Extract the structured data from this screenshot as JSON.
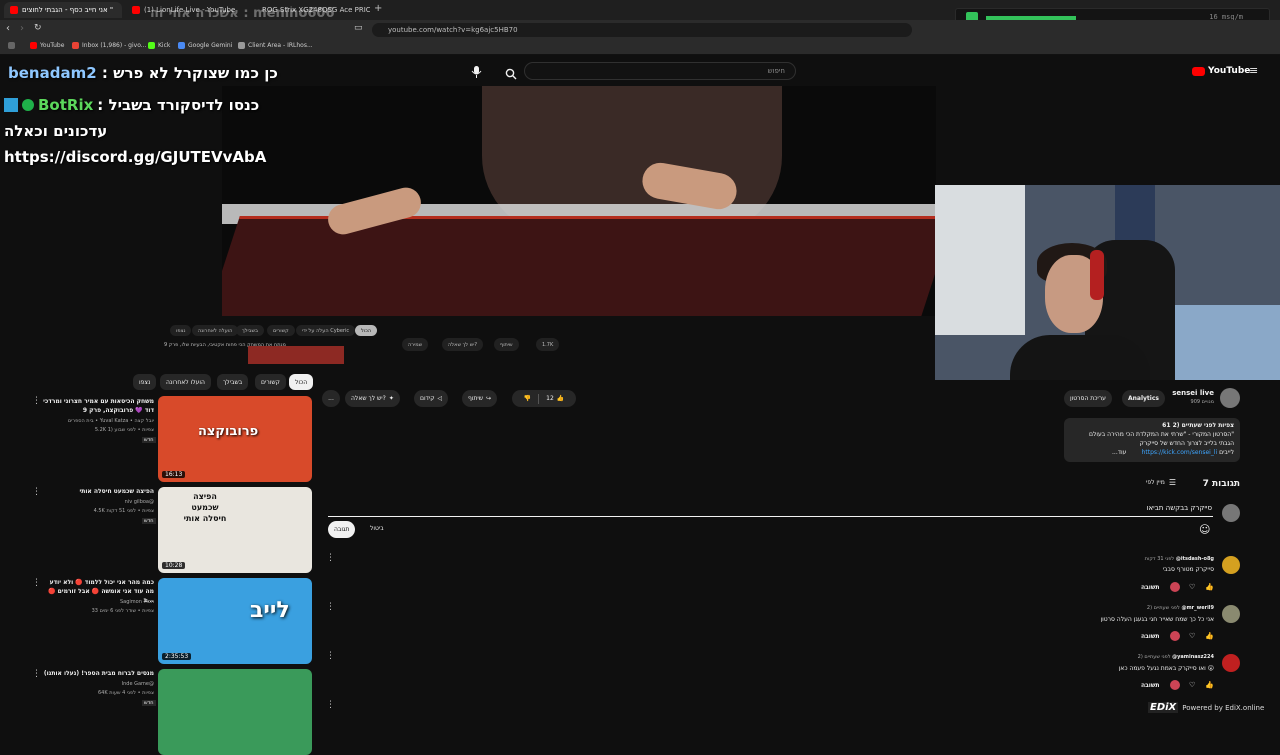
{
  "browser": {
    "tabs": [
      {
        "label": "אני חייב כסף - הגבתי לחוצים \"",
        "active": true
      },
      {
        "label": "(1) LionLife Live - YouTube",
        "active": false
      },
      {
        "label": "ROG Strix XG248QSG Ace PRICE - з",
        "active": false
      }
    ],
    "tab_overlay_text": "אשכרה אחי זה : menino606",
    "url": "youtube.com/watch?v=kg6ajc5HB70",
    "bookmarks": [
      "YouTube",
      "Inbox (1,986) - givo...",
      "Kick",
      "Google Gemini",
      "Client Area - IRLhos..."
    ],
    "volume_readout": "16 msg/m",
    "volume_level": 0.5
  },
  "youtube": {
    "logo_text": "YouTube",
    "search_placeholder": "חיפוש"
  },
  "overlay_chat": {
    "line1_user": "benadam2",
    "line1_text": ": כן כמו שצוקרל לא פרש",
    "line2_user": "BotRix",
    "line2_text": ": כנסו לדיסקורד בשביל",
    "line3": "עדכונים וכאלה",
    "line4": "https://discord.gg/GJUTEVvAbA"
  },
  "channel": {
    "name": "sensei live",
    "subscribers": "909 מנויים",
    "analytics_label": "Analytics",
    "edit_label": "עריכת הסרטון"
  },
  "actions": {
    "likes": "12",
    "share": "שיתוף",
    "promote": "קידום",
    "ask": "יש לך שאלה?",
    "more": "..."
  },
  "mini_actions": {
    "likes": "1.7K",
    "share": "שיתוף",
    "ask": "יש לך שאלה?",
    "save": "שמירה",
    "chips": [
      "הכול",
      "העלה על ידי Cyberic",
      "קשורים",
      "בשבילך",
      "הועלה לאחרונה",
      "נצפו"
    ],
    "video_title": "מנתח את המשחק הכי פחות אקטיבי, הבעיות שלו, פרק 9"
  },
  "description": {
    "line1": "61 צפיות  לפני שעתיים (2",
    "line2": "הסרטון המקורי - \"שרתי את המקלדת הכי מהירה בעולם\"",
    "line3": "הגבתי בלייב לצרוך החדש של סייקרק",
    "line4_prefix": "לייבים",
    "line4_link": "https://kick.com/sensei_li",
    "more": "...עוד"
  },
  "chips": [
    "הכול",
    "קשורים",
    "בשבילך",
    "הועלו לאחרונה",
    "נצפו"
  ],
  "comments": {
    "count_label": "7 תגובות",
    "sort_label": "מיין לפי",
    "draft_text": "סייקרק בבקשה תביאו",
    "cancel_label": "ביטול",
    "reply_label": "תגובה",
    "items": [
      {
        "user": "@itsdash-o8g",
        "time": "לפני 31 דקות",
        "text": "סייקרק מטורף סבבי",
        "reply": "תשובה",
        "avatar_color": "#d4a020"
      },
      {
        "user": "@mr_weril9",
        "time": "לפני שעתיים (2",
        "text": "אני כל כך שמח שאייר חגי בגעגן העלה סרטון",
        "reply": "תשובה",
        "avatar_color": "#8a8a70"
      },
      {
        "user": "@yaminasz224",
        "time": "לפני שעתיים (2",
        "text": "ואו סייקרק באמת נגעל פעמה כאן 😮",
        "reply": "תשובה",
        "avatar_color": "#c02020"
      }
    ]
  },
  "sidebar_videos": [
    {
      "title": "משחק הכיסאות עם אמיר חצרוני ומרדכי דוד 💜 פרובוקצה, פרק 9",
      "channel": "בית הספרים • Yuval Katza • יובל קצה",
      "meta": "5.2K צפיות • לפני שבוע (1",
      "badge": "חדש",
      "duration": "16:13",
      "thumb_text": "פרובוקצה",
      "thumb_color": "#d84a2a"
    },
    {
      "title": "הפיצה שכמעט חיסלה אותי",
      "channel": "niv gilboa@",
      "meta": "4.5K צפיות • לפני 51 דקות",
      "badge": "חדש",
      "duration": "10:28",
      "thumb_text": "הפיצה שכמעט חיסלה אותי",
      "thumb_color": "#e9e6df"
    },
    {
      "title": "כמה מהר אני יכול ללמוד 🔴 ולא יודע מה עוד אני אומשה 🔴 אבל זורמים 🔴 ב...",
      "channel": "Sagimon Mon",
      "meta": "33 צפיות • שודר לפני 6 ימים",
      "badge": "",
      "duration": "2:35:53",
      "thumb_text": "לייב",
      "thumb_color": "#3aa0e0"
    },
    {
      "title": "מנסים לברוח מבית הספר! (נעלו אותנו)",
      "channel": "Inde Game@",
      "meta": "64K צפיות • לפני 4 שעות",
      "badge": "חדש",
      "duration": "",
      "thumb_text": "",
      "thumb_color": "#3a9a5a"
    }
  ],
  "watermark": "Powered by EdiX.online"
}
